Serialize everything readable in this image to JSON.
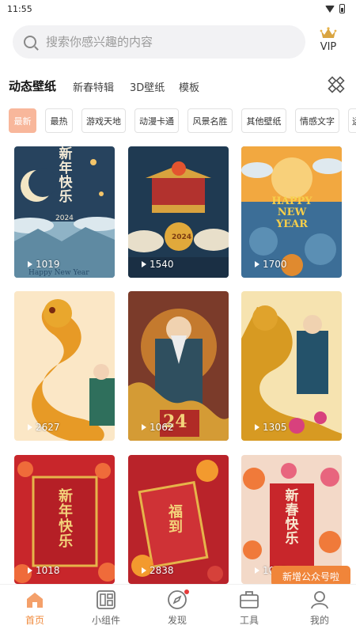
{
  "status_bar": {
    "time": "11:55"
  },
  "search": {
    "placeholder": "搜索你感兴趣的内容"
  },
  "vip": {
    "label": "VIP"
  },
  "category_tabs": [
    "动态壁纸",
    "新春特辑",
    "3D壁纸",
    "模板"
  ],
  "filter_chips": [
    "最新",
    "最热",
    "游戏天地",
    "动漫卡通",
    "风景名胜",
    "其他壁纸",
    "情感文字",
    "运"
  ],
  "wallpapers": [
    {
      "count": "1019",
      "text": "新年快乐",
      "sub": "2024",
      "footer": "Happy New Year"
    },
    {
      "count": "1540",
      "text": "",
      "sub": "2024"
    },
    {
      "count": "1700",
      "text": "HAPPY NEW YEAR"
    },
    {
      "count": "2627"
    },
    {
      "count": "1062",
      "sub": "24"
    },
    {
      "count": "1305"
    },
    {
      "count": "1018",
      "text": "新年快乐"
    },
    {
      "count": "2838",
      "text": "福到"
    },
    {
      "count": "1055",
      "text": "新春快乐"
    }
  ],
  "toast": {
    "text": "新增公众号啦"
  },
  "bottom_nav": [
    {
      "label": "首页",
      "icon": "home-icon",
      "active": true
    },
    {
      "label": "小组件",
      "icon": "widget-icon"
    },
    {
      "label": "发现",
      "icon": "compass-icon"
    },
    {
      "label": "工具",
      "icon": "toolbox-icon"
    },
    {
      "label": "我的",
      "icon": "profile-icon"
    }
  ],
  "colors": {
    "accent": "#f08a3c",
    "chip_active": "#f8b79b",
    "card_red": "#c8262b",
    "card_gold": "#e6a532"
  }
}
